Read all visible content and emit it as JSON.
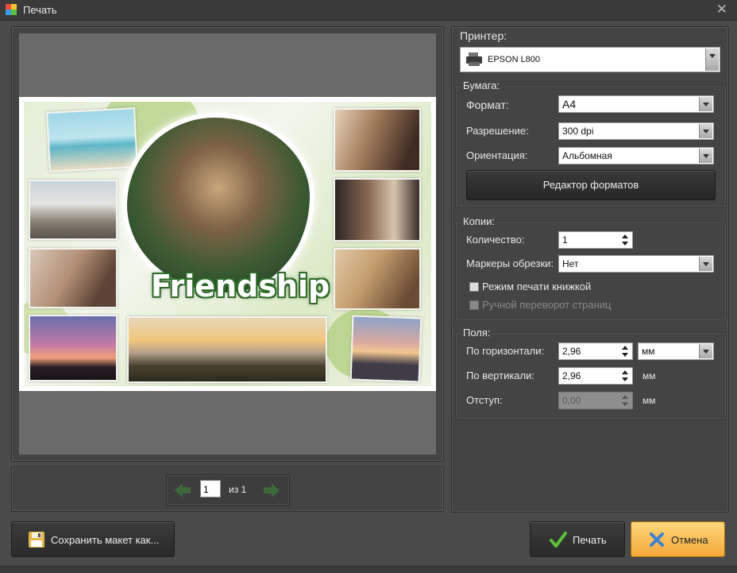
{
  "window": {
    "title": "Печать",
    "close_icon": "close-icon"
  },
  "preview": {
    "collage_text": "Friendship",
    "pager": {
      "current_page": "1",
      "of_label": "из 1"
    }
  },
  "printer": {
    "label": "Принтер:",
    "selected": "EPSON L800"
  },
  "paper": {
    "section": "Бумага:",
    "format_label": "Формат:",
    "format_value": "A4",
    "resolution_label": "Разрешение:",
    "resolution_value": "300 dpi",
    "orientation_label": "Ориентация:",
    "orientation_value": "Альбомная",
    "format_editor_button": "Редактор форматов"
  },
  "copies": {
    "section": "Копии:",
    "count_label": "Количество:",
    "count_value": "1",
    "crop_marks_label": "Маркеры обрезки:",
    "crop_marks_value": "Нет",
    "booklet_label": "Режим печати книжкой",
    "manual_flip_label": "Ручной переворот страниц"
  },
  "margins": {
    "section": "Поля:",
    "horizontal_label": "По горизонтали:",
    "horizontal_value": "2,96",
    "units_value": "мм",
    "vertical_label": "По вертикали:",
    "vertical_value": "2,96",
    "vertical_unit": "мм",
    "indent_label": "Отступ:",
    "indent_value": "0,00",
    "indent_unit": "мм"
  },
  "footer": {
    "save_label": "Сохранить макет как...",
    "print_label": "Печать",
    "cancel_label": "Отмена"
  },
  "colors": {
    "accent_cancel": "#f4a83a",
    "panel": "#444444",
    "nav_arrow": "#4caf50"
  }
}
